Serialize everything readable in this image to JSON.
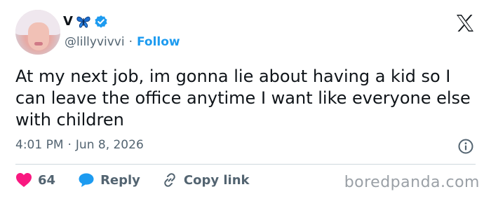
{
  "tweet": {
    "author": {
      "name": "V",
      "emoji_icon": "butterfly-icon",
      "verified": true,
      "handle": "@lillyvivvi",
      "separator": "·",
      "follow_label": "Follow"
    },
    "text": "At my next job, im gonna lie about having a kid so I can leave the office anytime I want like everyone else with children",
    "time": "4:01 PM",
    "date_separator": "·",
    "date": "Jun 8, 2026",
    "likes_count": "64",
    "reply_label": "Reply",
    "copy_link_label": "Copy link"
  },
  "brand": {
    "logo": "x-logo-icon"
  },
  "watermark": "boredpanda.com",
  "colors": {
    "text": "#0f1419",
    "secondary": "#536471",
    "accent": "#1d9bf0",
    "like": "#f91880",
    "divider": "#cfd9de"
  }
}
